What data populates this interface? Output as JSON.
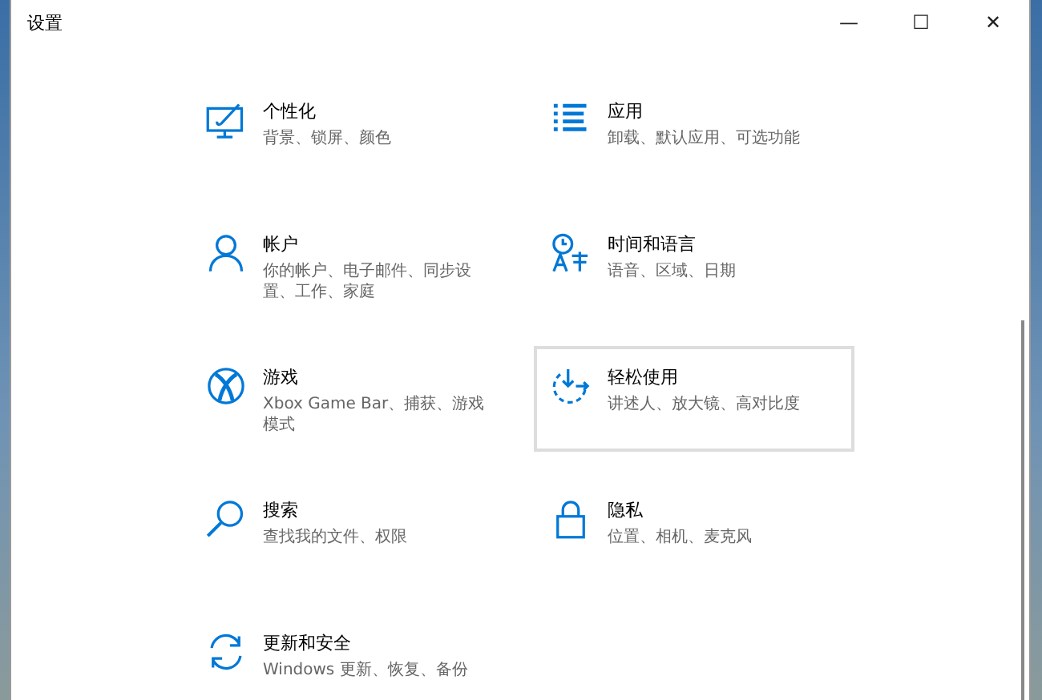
{
  "window": {
    "title": "设置",
    "controls": [
      "—",
      "☐",
      "✕"
    ]
  },
  "categories": [
    {
      "title": "个性化",
      "description": "背景、锁屏、颜色",
      "hovered": false
    },
    {
      "title": "应用",
      "description": "卸载、默认应用、可选功能",
      "hovered": false
    },
    {
      "title": "帐户",
      "description": "你的帐户、电子邮件、同步设置、工作、家庭",
      "hovered": false
    },
    {
      "title": "时间和语言",
      "description": "语音、区域、日期",
      "hovered": false
    },
    {
      "title": "游戏",
      "description": "Xbox Game Bar、捕获、游戏模式",
      "hovered": false
    },
    {
      "title": "轻松使用",
      "description": "讲述人、放大镜、高对比度",
      "hovered": true
    },
    {
      "title": "搜索",
      "description": "查找我的文件、权限",
      "hovered": false
    },
    {
      "title": "隐私",
      "description": "位置、相机、麦克风",
      "hovered": false
    },
    {
      "title": "更新和安全",
      "description": "Windows 更新、恢复、备份",
      "hovered": false
    }
  ]
}
